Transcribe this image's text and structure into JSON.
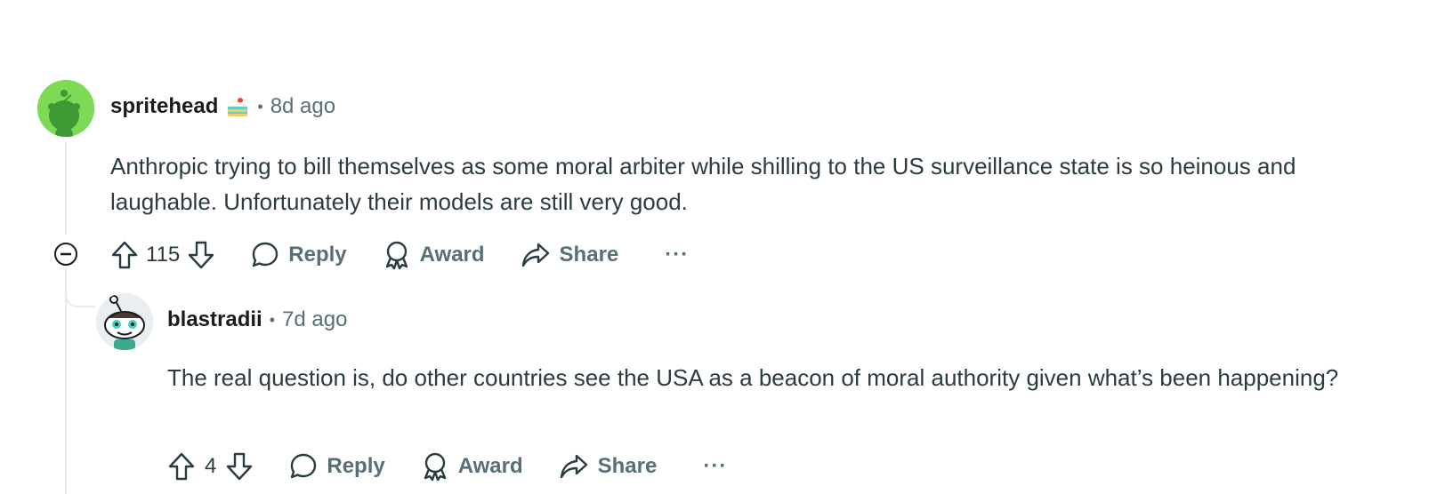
{
  "comments": [
    {
      "username": "spritehead",
      "flair_icon": "cake-icon",
      "separator": "•",
      "timestamp": "8d ago",
      "body": "Anthropic trying to bill themselves as some moral arbiter while shilling to the US surveillance state is so heinous and laughable. Unfortunately their models are still very good.",
      "votes": "115",
      "reply_label": "Reply",
      "award_label": "Award",
      "share_label": "Share",
      "more_label": "···",
      "avatar_color": "#7ed957"
    },
    {
      "username": "blastradii",
      "separator": "•",
      "timestamp": "7d ago",
      "body": "The real question is, do other countries see the USA as a beacon of moral authority given what’s been happening?",
      "votes": "4",
      "reply_label": "Reply",
      "award_label": "Award",
      "share_label": "Share",
      "more_label": "···"
    }
  ],
  "colors": {
    "meta": "#576f76",
    "body_text": "#2a3c42",
    "thread_line": "#e5ebee"
  }
}
